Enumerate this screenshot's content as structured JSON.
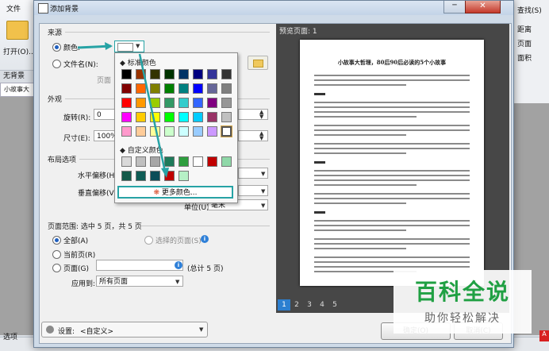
{
  "background_app": {
    "file_menu": "文件",
    "open_label": "打开(O)...",
    "no_background": "无背景",
    "doc_tab": "小故事大",
    "right_items": [
      "查找(S)",
      "距离",
      "页面",
      "面积"
    ],
    "bottom_label": "选项"
  },
  "dialog": {
    "title": "添加背景",
    "minimize_glyph": "─",
    "close_glyph": "✕"
  },
  "source": {
    "section_title": "来源",
    "color_label": "颜色:",
    "file_label": "文件名(N):",
    "page_label": "页面"
  },
  "appearance": {
    "section_title": "外观",
    "rotation_label": "旋转(R):",
    "rotation_value": "0",
    "size_label": "尺寸(E):",
    "size_value": "100%"
  },
  "layout": {
    "section_title": "布局选项",
    "horizontal_offset_label": "水平偏移(H)",
    "vertical_offset_label": "垂直偏移(V)",
    "unit_label": "单位(U):",
    "unit_value": "毫米"
  },
  "page_range": {
    "section_title": "页面范围: 选中 5 页，共 5 页",
    "all_label": "全部(A)",
    "selected_label": "选择的页面(S)",
    "current_label": "当前页(R)",
    "pages_label": "页面(G)",
    "pages_total": "(总计 5 页)",
    "apply_to_label": "应用到:",
    "apply_to_value": "所有页面"
  },
  "picker": {
    "standard_title": "标准颜色",
    "custom_title": "自定义颜色",
    "more_colors": "更多颜色...",
    "standard_colors": [
      [
        "#000000",
        "#993300",
        "#333300",
        "#003300",
        "#003366",
        "#000080",
        "#333399",
        "#333333"
      ],
      [
        "#800000",
        "#ff6600",
        "#808000",
        "#008000",
        "#008080",
        "#0000ff",
        "#666699",
        "#808080"
      ],
      [
        "#ff0000",
        "#ff9900",
        "#99cc00",
        "#339966",
        "#33cccc",
        "#3366ff",
        "#800080",
        "#969696"
      ],
      [
        "#ff00ff",
        "#ffcc00",
        "#ffff00",
        "#00ff00",
        "#00ffff",
        "#00ccff",
        "#993366",
        "#c0c0c0"
      ],
      [
        "#ff99cc",
        "#ffcc99",
        "#ffff99",
        "#ccffcc",
        "#ccffff",
        "#99ccff",
        "#cc99ff",
        "#ffffff"
      ]
    ],
    "custom_colors": [
      [
        "#d9d9d9",
        "#bfbfbf",
        "#a6a6a6",
        "#1f7a5a",
        "#2e9e3e",
        "#ffffff",
        "#c00000",
        "#8fd8a8"
      ],
      [
        "#145a4a",
        "#0f5c55",
        "#0b4d58",
        "#c00000",
        "#b6f0c6"
      ]
    ]
  },
  "settings": {
    "label": "设置:",
    "value": "<自定义>"
  },
  "preview": {
    "label": "预览页面: 1",
    "page_title": "小故事大哲理，80后90后必读的5个小故事",
    "pages": [
      "1",
      "2",
      "3",
      "4",
      "5"
    ]
  },
  "buttons": {
    "ok": "确定(O)",
    "cancel": "取消(C)"
  },
  "watermark": {
    "main": "百科全说",
    "sub": "助你轻松解决"
  },
  "colors": {
    "accent_arrow": "#27a3a5",
    "selected_page": "#2c7fd0"
  }
}
